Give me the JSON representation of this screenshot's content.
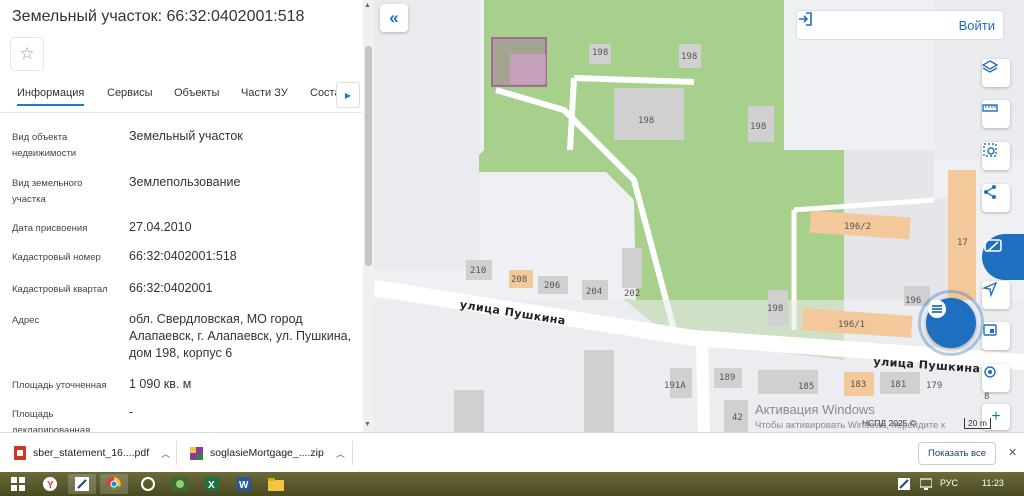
{
  "panel": {
    "title": "Земельный участок: 66:32:0402001:518",
    "star_icon": "star-outline-icon",
    "tabs": [
      {
        "label": "Информация",
        "active": true
      },
      {
        "label": "Сервисы",
        "active": false
      },
      {
        "label": "Объекты",
        "active": false
      },
      {
        "label": "Части ЗУ",
        "active": false
      },
      {
        "label": "Состав ЗУ",
        "active": false
      }
    ],
    "rows": [
      {
        "label": "Вид объекта недвижимости",
        "value": "Земельный участок"
      },
      {
        "label": "Вид земельного участка",
        "value": "Землепользование"
      },
      {
        "label": "Дата присвоения",
        "value": "27.04.2010"
      },
      {
        "label": "Кадастровый номер",
        "value": "66:32:0402001:518"
      },
      {
        "label": "Кадастровый квартал",
        "value": "66:32:0402001"
      },
      {
        "label": "Адрес",
        "value": "обл. Свердловская, МО город Алапаевск, г. Алапаевск, ул. Пушкина, дом 198, корпус 6"
      },
      {
        "label": "Площадь уточненная",
        "value": "1 090 кв. м"
      },
      {
        "label": "Площадь декларированная",
        "value": "-"
      }
    ]
  },
  "map": {
    "login_label": "Войти",
    "login_icon": "login-arrow-icon",
    "collapse_icon": "double-chevron-left-icon",
    "streets": [
      "улица Пушкина",
      "улица Пушкина"
    ],
    "building_labels": [
      "198",
      "198",
      "198",
      "198",
      "198",
      "196/2",
      "196/1",
      "17",
      "196",
      "210",
      "208",
      "206",
      "204",
      "202",
      "191А",
      "189",
      "185",
      "183",
      "181",
      "179",
      "42",
      "8"
    ],
    "tools": [
      "layers-icon",
      "ruler-icon",
      "select-area-icon",
      "share-icon",
      "print-icon",
      "navigate-icon",
      "panel-icon",
      "locate-icon",
      "zoom-in-icon"
    ],
    "fab_icon": "menu-list-icon",
    "watermark_title": "Активация Windows",
    "watermark_text": "Чтобы активировать Windows, перейдите к параметрам компьютера.",
    "attribution": "НСПД 2025 ©",
    "scale": "20 m"
  },
  "downloads": {
    "items": [
      {
        "name": "sber_statement_16....pdf",
        "icon": "pdf-file-icon"
      },
      {
        "name": "soglasieMortgage_....zip",
        "icon": "zip-file-icon"
      }
    ],
    "show_all": "Показать все"
  },
  "taskbar": {
    "icons": [
      "start-icon",
      "yandex-browser-icon",
      "app-icon",
      "chrome-icon",
      "app2-icon",
      "file-manager-icon",
      "excel-icon",
      "word-icon",
      "explorer-icon"
    ],
    "language": "РУС",
    "time": "11:23"
  },
  "colors": {
    "accent": "#1f6fc1",
    "parcel": "#a0519b",
    "green": "#a8d08d",
    "building": "#d0d0d0",
    "orange_building": "#f3c89a"
  }
}
